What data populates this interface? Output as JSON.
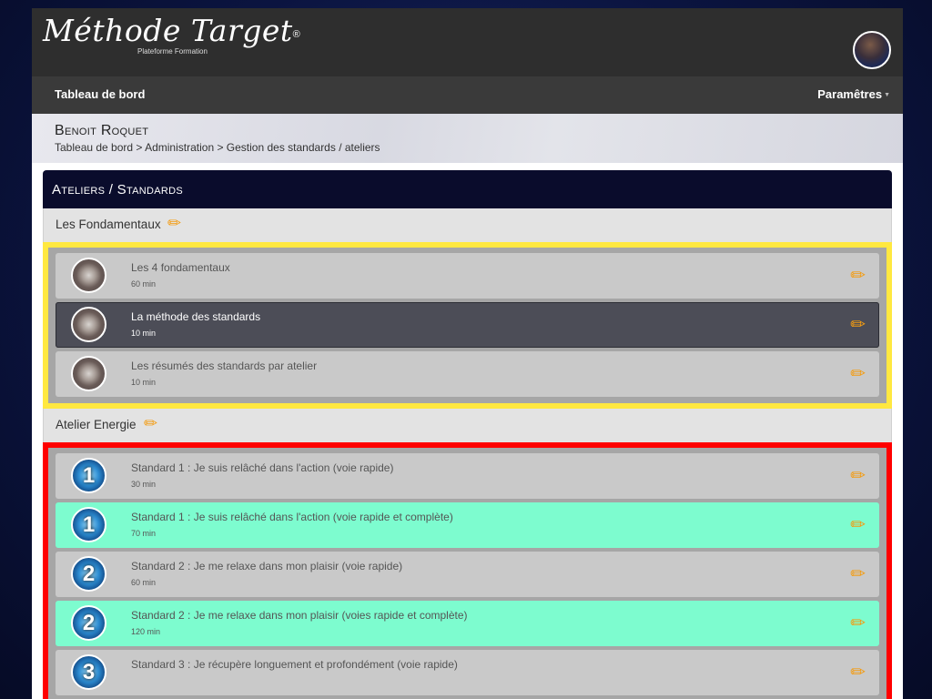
{
  "header": {
    "logo_main": "Méthode Target",
    "logo_mark": "®",
    "logo_sub": "Plateforme Formation"
  },
  "nav": {
    "dashboard": "Tableau de bord",
    "settings": "Paramêtres"
  },
  "profile": {
    "name": "Benoit Roquet",
    "breadcrumb": "Tableau de bord > Administration > Gestion des standards / ateliers"
  },
  "panel": {
    "title": "Ateliers / Standards"
  },
  "sections": [
    {
      "title": "Les Fondamentaux",
      "items": [
        {
          "title": "Les 4 fondamentaux",
          "duration": "60 min"
        },
        {
          "title": "La méthode des standards",
          "duration": "10 min"
        },
        {
          "title": "Les résumés des standards par atelier",
          "duration": "10 min"
        }
      ]
    },
    {
      "title": "Atelier Energie",
      "items": [
        {
          "title": "Standard 1 : Je suis relâché dans l'action (voie rapide)",
          "duration": "30 min",
          "badge": "1"
        },
        {
          "title": "Standard 1 : Je suis relâché dans l'action (voie rapide et complète)",
          "duration": "70 min",
          "badge": "1"
        },
        {
          "title": "Standard 2 : Je me relaxe dans mon plaisir (voie rapide)",
          "duration": "60 min",
          "badge": "2"
        },
        {
          "title": "Standard 2 : Je me relaxe dans mon plaisir (voies rapide et complète)",
          "duration": "120 min",
          "badge": "2"
        },
        {
          "title": "Standard 3 : Je récupère longuement et profondément (voie rapide)",
          "duration": "",
          "badge": "3"
        }
      ]
    }
  ],
  "icons": {
    "edit": "pencil-icon",
    "caret": "caret-down-icon"
  },
  "colors": {
    "accent": "#f39c12",
    "yellow_group": "#ffe840",
    "red_group": "#ff0000",
    "green_item": "#7dfccf",
    "panel_head": "#0a0c2c"
  }
}
